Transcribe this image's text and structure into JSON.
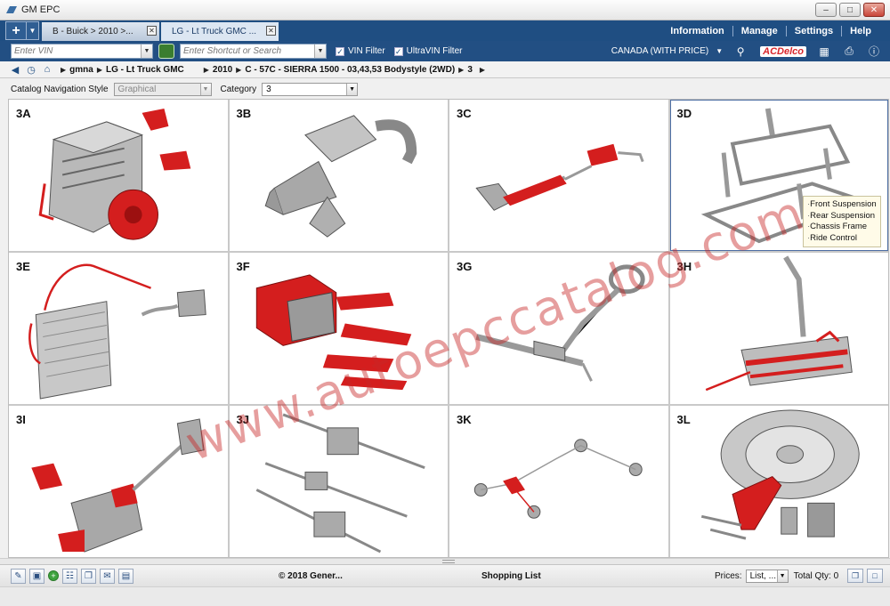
{
  "window": {
    "title": "GM EPC"
  },
  "tabs": [
    {
      "label": "B - Buick > 2010 >...",
      "active": false
    },
    {
      "label": "LG - Lt Truck GMC ...",
      "active": true
    }
  ],
  "top_menu": [
    "Information",
    "Manage",
    "Settings",
    "Help"
  ],
  "toolbar": {
    "vin_placeholder": "Enter VIN",
    "shortcut_placeholder": "Enter Shortcut or Search",
    "vin_filter": "VIN Filter",
    "ultravin_filter": "UltraVIN Filter",
    "region": "CANADA (WITH PRICE)",
    "brand": "ACDelco"
  },
  "breadcrumb": {
    "items": [
      "gmna",
      "LG - Lt Truck GMC",
      "2010",
      "C - 57C - SIERRA 1500 - 03,43,53 Bodystyle (2WD)",
      "3"
    ]
  },
  "options": {
    "nav_style_label": "Catalog Navigation Style",
    "nav_style_value": "Graphical",
    "category_label": "Category",
    "category_value": "3"
  },
  "grid": {
    "cells": [
      {
        "code": "3A"
      },
      {
        "code": "3B"
      },
      {
        "code": "3C"
      },
      {
        "code": "3D"
      },
      {
        "code": "3E"
      },
      {
        "code": "3F"
      },
      {
        "code": "3G"
      },
      {
        "code": "3H"
      },
      {
        "code": "3I"
      },
      {
        "code": "3J"
      },
      {
        "code": "3K"
      },
      {
        "code": "3L"
      }
    ],
    "tooltip_items": [
      "Front Suspension",
      "Rear Suspension",
      "Chassis Frame",
      "Ride Control"
    ]
  },
  "footer": {
    "copyright": "© 2018 Gener...",
    "shopping_list": "Shopping List",
    "prices_label": "Prices:",
    "prices_value": "List, ...",
    "total_qty": "Total Qty: 0"
  },
  "watermark": "www.autoepccatalog.com",
  "colors": {
    "header_blue": "#1f4e82",
    "part_red": "#d41e1e",
    "part_gray": "#9a9a9a"
  }
}
